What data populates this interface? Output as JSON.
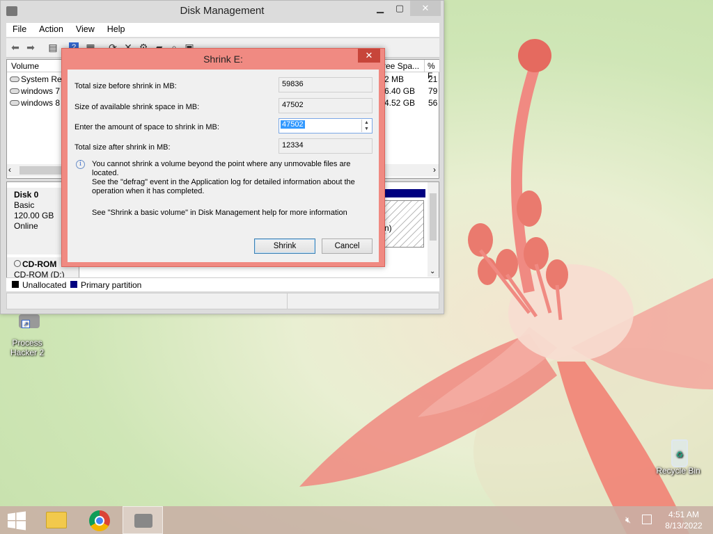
{
  "main_window": {
    "title": "Disk Management",
    "menu": [
      "File",
      "Action",
      "View",
      "Help"
    ],
    "columns": {
      "volume": "Volume",
      "free_space": "ree Spa...",
      "percent_free": "% F"
    },
    "volumes": [
      {
        "name": "System Res",
        "free": "2 MB",
        "pct": "21"
      },
      {
        "name": "windows 7",
        "free": "6.40 GB",
        "pct": "79"
      },
      {
        "name": "windows 8",
        "free": "4.52 GB",
        "pct": "56"
      }
    ],
    "disk0": {
      "name": "Disk 0",
      "type": "Basic",
      "size": "120.00 GB",
      "status": "Online",
      "partition_fragment": "n)"
    },
    "cdrom": {
      "name": "CD-ROM",
      "label": "CD-ROM (D:)"
    },
    "legend": {
      "unallocated": "Unallocated",
      "primary": "Primary partition",
      "unallocated_color": "#000000",
      "primary_color": "#000080"
    }
  },
  "dialog": {
    "title": "Shrink E:",
    "total_before_label": "Total size before shrink in MB:",
    "total_before_value": "59836",
    "available_label": "Size of available shrink space in MB:",
    "available_value": "47502",
    "enter_label": "Enter the amount of space to shrink in MB:",
    "enter_value": "47502",
    "total_after_label": "Total size after shrink in MB:",
    "total_after_value": "12334",
    "info_line1": "You cannot shrink a volume beyond the point where any unmovable files are located.",
    "info_line2": "See the \"defrag\" event in the Application log for detailed information about the",
    "info_line3": "operation when it has completed.",
    "help_text": "See \"Shrink a basic volume\" in Disk Management help for more information",
    "shrink_button": "Shrink",
    "cancel_button": "Cancel"
  },
  "desktop": {
    "process_hacker": {
      "line1": "Process",
      "line2": "Hacker 2"
    },
    "recycle_bin": "Recycle Bin"
  },
  "taskbar": {
    "time": "4:51 AM",
    "date": "8/13/2022",
    "accent": "#c8afa5"
  }
}
